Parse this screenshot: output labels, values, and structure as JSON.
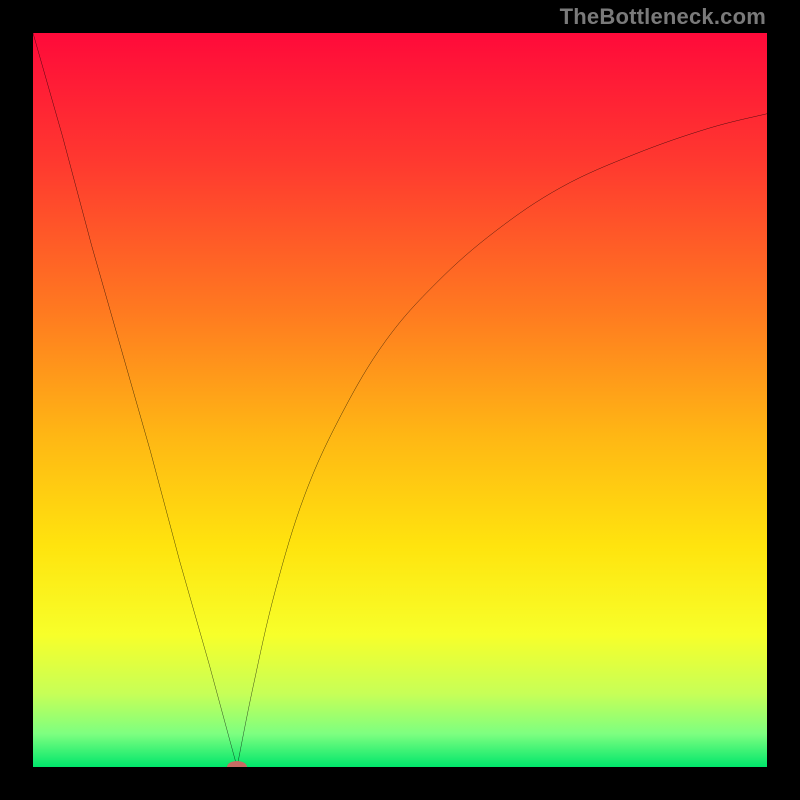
{
  "watermark": "TheBottleneck.com",
  "chart_data": {
    "type": "line",
    "title": "",
    "xlabel": "",
    "ylabel": "",
    "xlim": [
      0,
      100
    ],
    "ylim": [
      0,
      100
    ],
    "grid": false,
    "legend": false,
    "gradient_stops": [
      {
        "pos": 0.0,
        "color": "#ff0a3a"
      },
      {
        "pos": 0.18,
        "color": "#ff3a2f"
      },
      {
        "pos": 0.38,
        "color": "#ff7a20"
      },
      {
        "pos": 0.55,
        "color": "#ffb714"
      },
      {
        "pos": 0.7,
        "color": "#ffe40e"
      },
      {
        "pos": 0.82,
        "color": "#f7ff2a"
      },
      {
        "pos": 0.9,
        "color": "#c7ff57"
      },
      {
        "pos": 0.955,
        "color": "#7dff80"
      },
      {
        "pos": 1.0,
        "color": "#00e66b"
      }
    ],
    "series": [
      {
        "name": "left-branch",
        "type": "line",
        "x": [
          0,
          4,
          8,
          12,
          16,
          20,
          24,
          27.8
        ],
        "y": [
          100,
          86,
          71,
          57,
          43,
          28,
          14,
          0
        ]
      },
      {
        "name": "right-branch",
        "type": "line",
        "x": [
          27.8,
          30,
          33,
          37,
          42,
          48,
          55,
          63,
          72,
          82,
          92,
          100
        ],
        "y": [
          0,
          11,
          24,
          37,
          48,
          58,
          66,
          73,
          79,
          83.5,
          87,
          89
        ]
      }
    ],
    "marker": {
      "x": 27.8,
      "y": 0,
      "color": "#c76b63"
    }
  }
}
